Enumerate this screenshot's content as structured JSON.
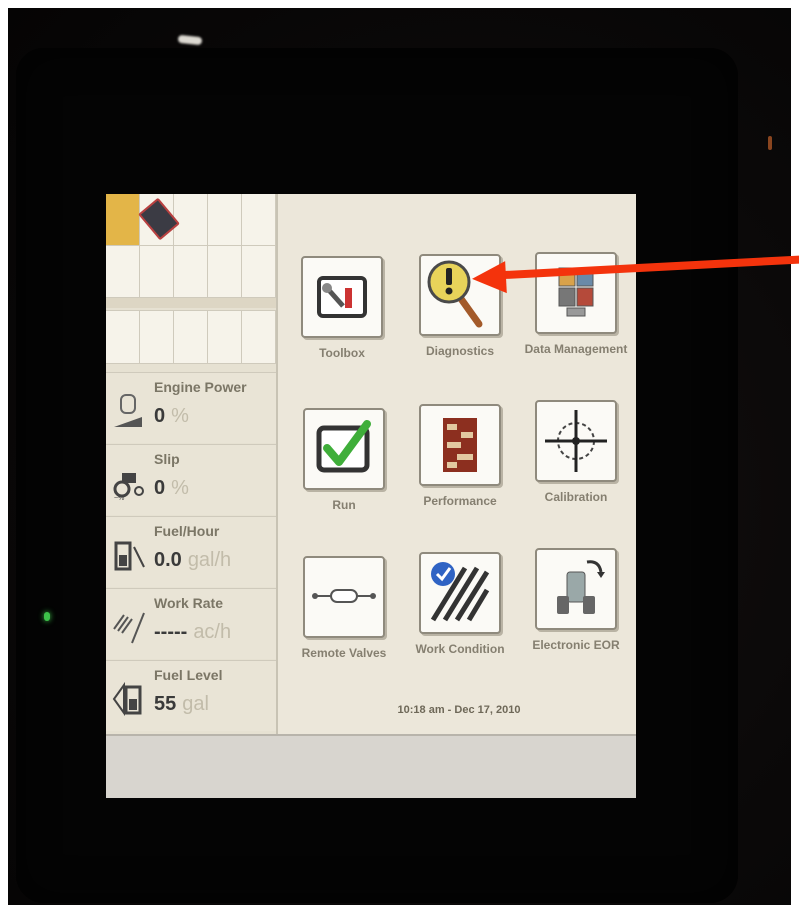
{
  "left_panel": {
    "gauges": [
      {
        "label": "Engine Power",
        "value": "0",
        "unit": "%"
      },
      {
        "label": "Slip",
        "value": "0",
        "unit": "%"
      },
      {
        "label": "Fuel/Hour",
        "value": "0.0",
        "unit": "gal/h"
      },
      {
        "label": "Work Rate",
        "value": "-----",
        "unit": "ac/h"
      },
      {
        "label": "Fuel Level",
        "value": "55",
        "unit": "gal"
      }
    ]
  },
  "apps": [
    {
      "label": "Toolbox",
      "icon": "toolbox-icon"
    },
    {
      "label": "Diagnostics",
      "icon": "diagnostics-magnifier-icon"
    },
    {
      "label": "Data Management",
      "icon": "data-management-icon"
    },
    {
      "label": "Run",
      "icon": "run-checkmark-icon"
    },
    {
      "label": "Performance",
      "icon": "performance-chart-icon"
    },
    {
      "label": "Calibration",
      "icon": "calibration-crosshair-icon"
    },
    {
      "label": "Remote Valves",
      "icon": "remote-valves-icon"
    },
    {
      "label": "Work Condition",
      "icon": "work-condition-icon"
    },
    {
      "label": "Electronic EOR",
      "icon": "electronic-eor-icon"
    }
  ],
  "footer": {
    "datetime": "10:18 am - Dec 17, 2010"
  },
  "annotation": {
    "arrow_color": "#f4330c"
  },
  "colors": {
    "screen_bg": "#ece7da",
    "active_cell": "#e3b548"
  }
}
